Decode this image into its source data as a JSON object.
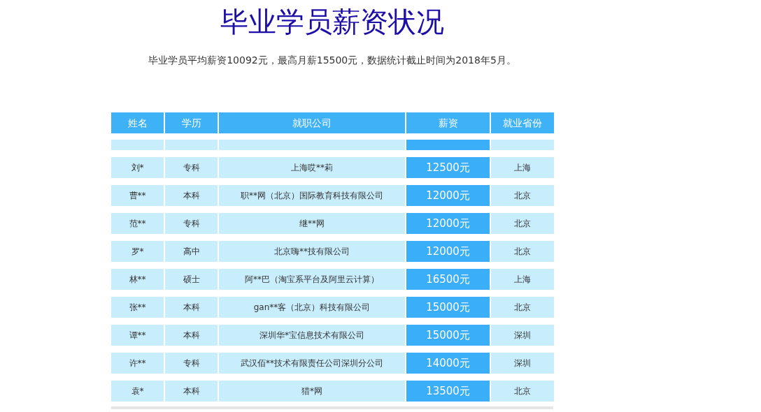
{
  "title": "毕业学员薪资状况",
  "summary": "毕业学员平均薪资10092元，最高月薪15500元，数据统计截止时间为2018年5月。",
  "table": {
    "columns": [
      "姓名",
      "学历",
      "就职公司",
      "薪资",
      "就业省份"
    ],
    "rows": [
      [
        "刘*",
        "专科",
        "上海哎**莉",
        "12500元",
        "上海"
      ],
      [
        "曹**",
        "本科",
        "职**网（北京）国际教育科技有限公司",
        "12000元",
        "北京"
      ],
      [
        "范**",
        "专科",
        "继**网",
        "12000元",
        "北京"
      ],
      [
        "罗*",
        "高中",
        "北京嗨**技有限公司",
        "12000元",
        "北京"
      ],
      [
        "林**",
        "硕士",
        "阿**巴（淘宝系平台及阿里云计算）",
        "16500元",
        "上海"
      ],
      [
        "张**",
        "本科",
        "gan**客（北京）科技有限公司",
        "15000元",
        "北京"
      ],
      [
        "谭**",
        "本科",
        "深圳华*宝信息技术有限公司",
        "15000元",
        "深圳"
      ],
      [
        "许**",
        "专科",
        "武汉佰**技术有限责任公司深圳分公司",
        "14000元",
        "深圳"
      ],
      [
        "袁*",
        "本科",
        "猎*网",
        "13500元",
        "北京"
      ]
    ]
  }
}
